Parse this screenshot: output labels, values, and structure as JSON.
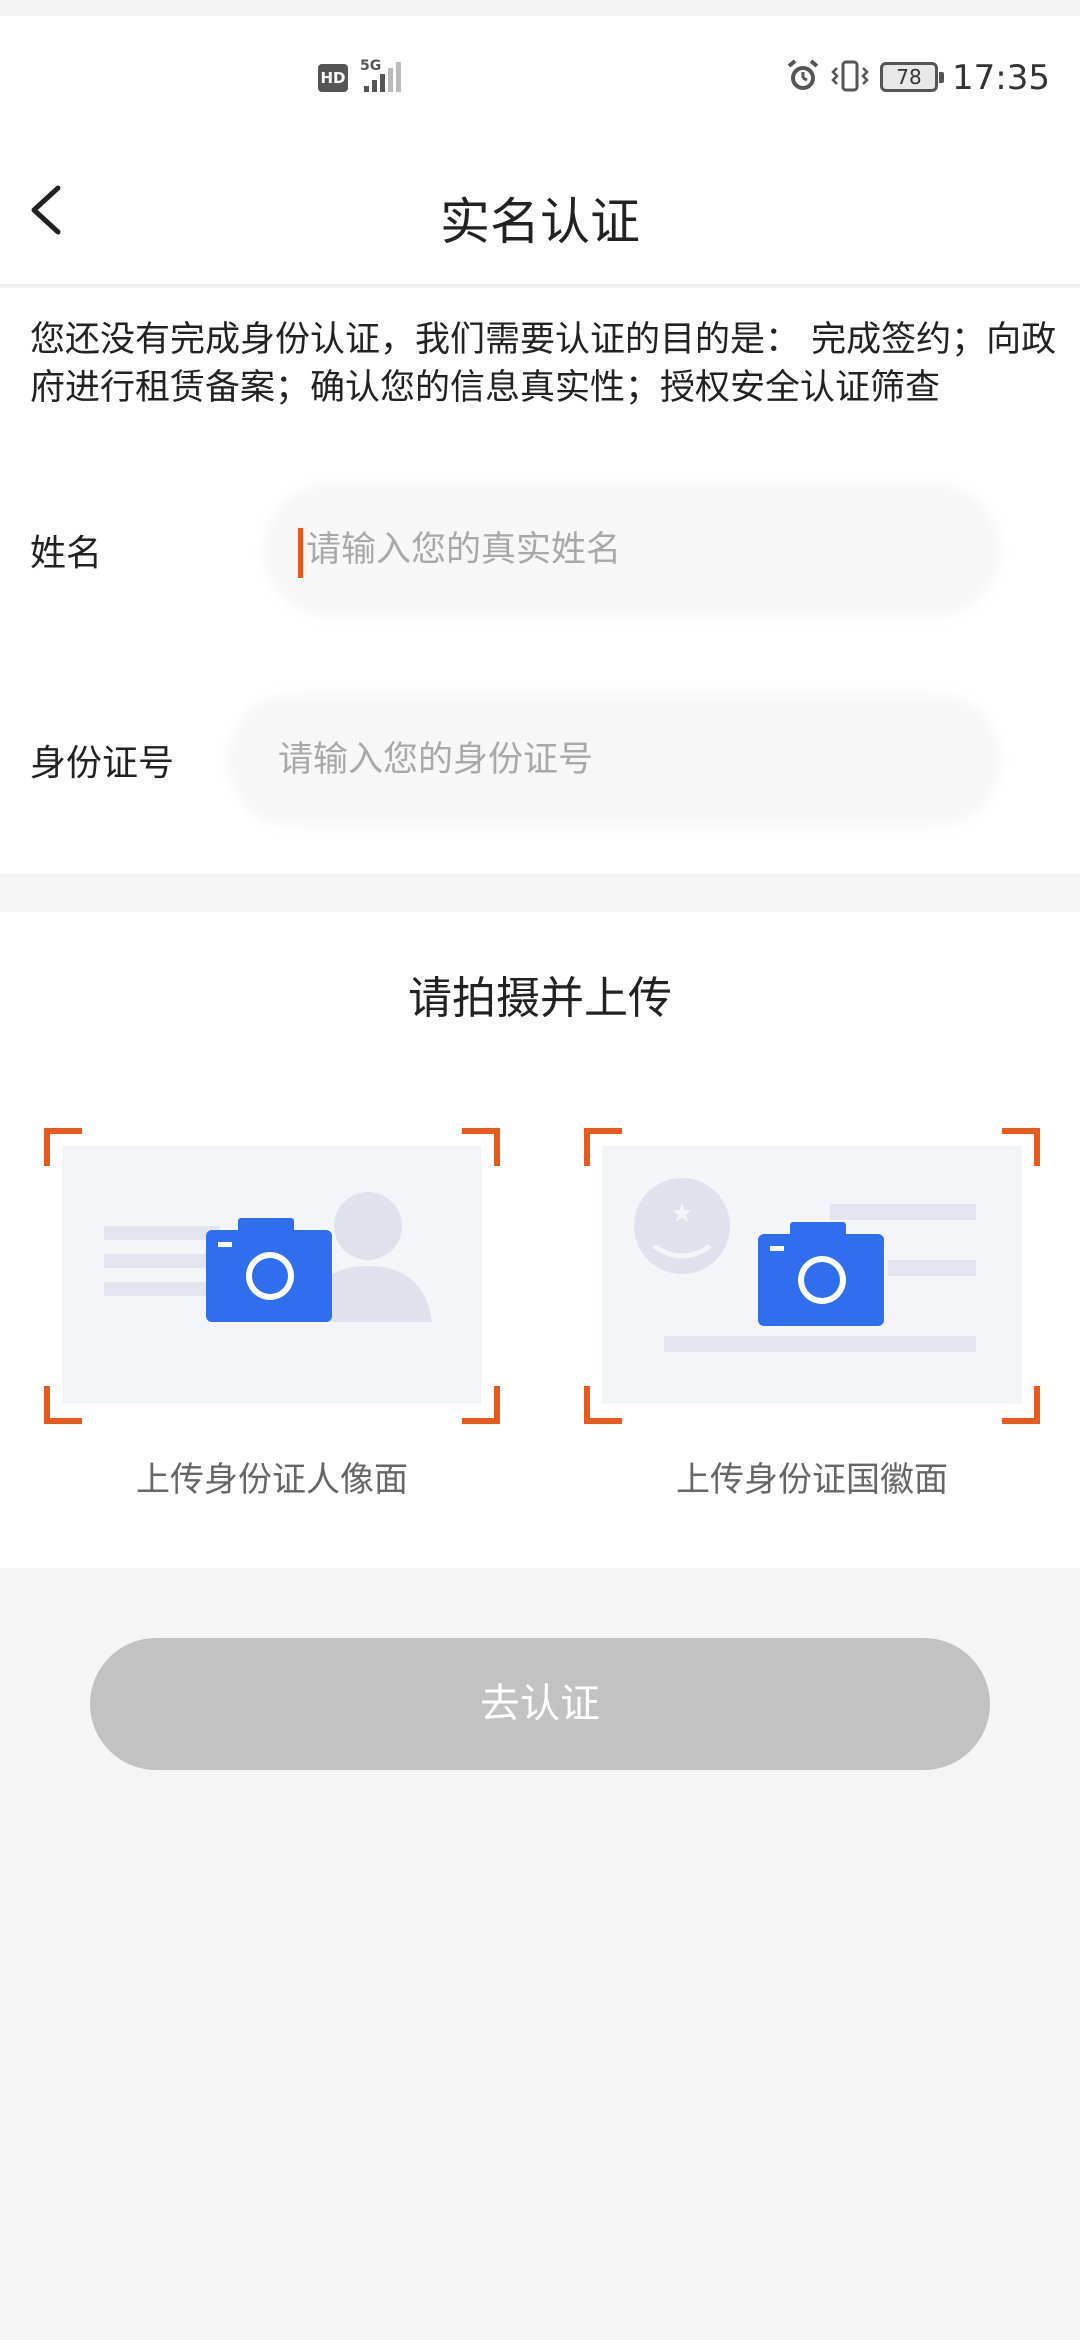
{
  "status_bar": {
    "hd": "HD",
    "network": "5G",
    "battery": "78",
    "time": "17:35"
  },
  "nav": {
    "title": "实名认证"
  },
  "form": {
    "notice": "您还没有完成身份认证，我们需要认证的目的是： 完成签约；向政府进行租赁备案；确认您的信息真实性；授权安全认证筛查",
    "name_label": "姓名",
    "name_placeholder": "请输入您的真实姓名",
    "id_label": "身份证号",
    "id_placeholder": "请输入您的身份证号"
  },
  "upload": {
    "title": "请拍摄并上传",
    "front_caption": "上传身份证人像面",
    "back_caption": "上传身份证国徽面"
  },
  "submit_label": "去认证",
  "colors": {
    "accent": "#e85a1c",
    "camera_blue": "#2f6fef",
    "disabled_button": "#c2c2c2",
    "page_background": "#f5f5f5"
  }
}
